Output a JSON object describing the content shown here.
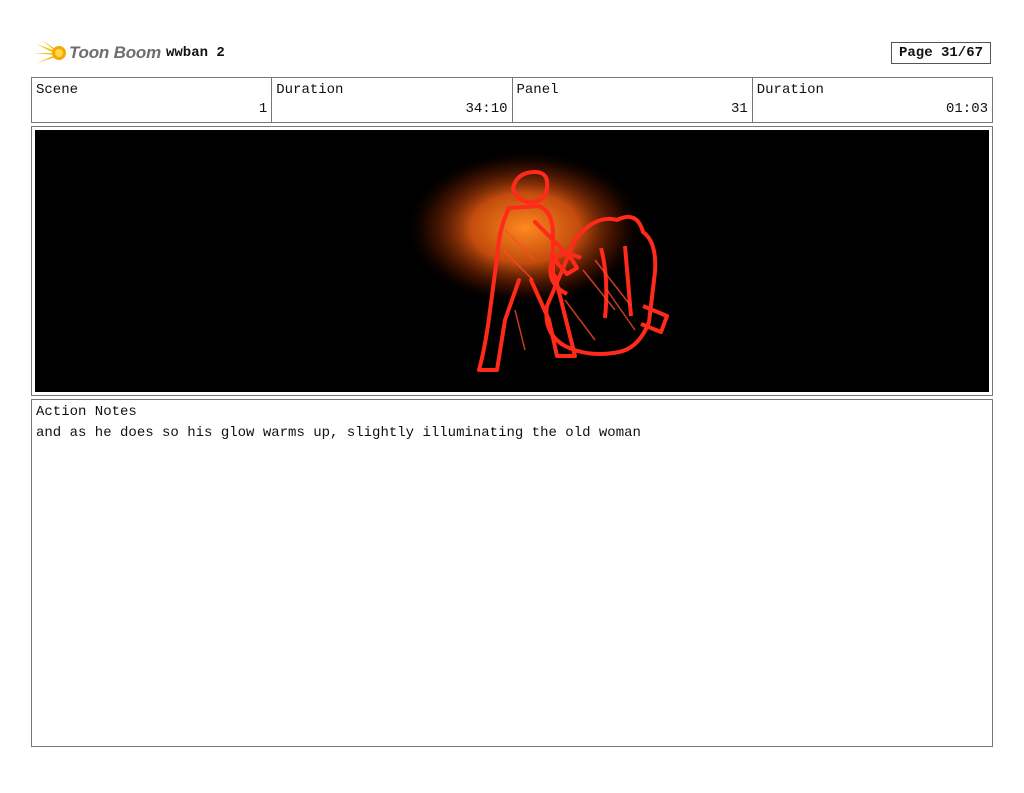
{
  "header": {
    "logo_text": "Toon Boom",
    "project_title": "wwban 2",
    "page_label": "Page 31/67"
  },
  "info": {
    "scene_label": "Scene",
    "scene_value": "1",
    "duration_label": "Duration",
    "duration_value": "34:10",
    "panel_label": "Panel",
    "panel_value": "31",
    "panel_duration_label": "Duration",
    "panel_duration_value": "01:03"
  },
  "panel": {
    "image_icon": "glowing-figure-sketch",
    "background_color": "#000000",
    "line_color": "#ff2a1a",
    "glow_color": "#ff7a1a"
  },
  "notes": {
    "label": "Action Notes",
    "text": "and as he does so his glow warms up, slightly illuminating the old woman"
  }
}
